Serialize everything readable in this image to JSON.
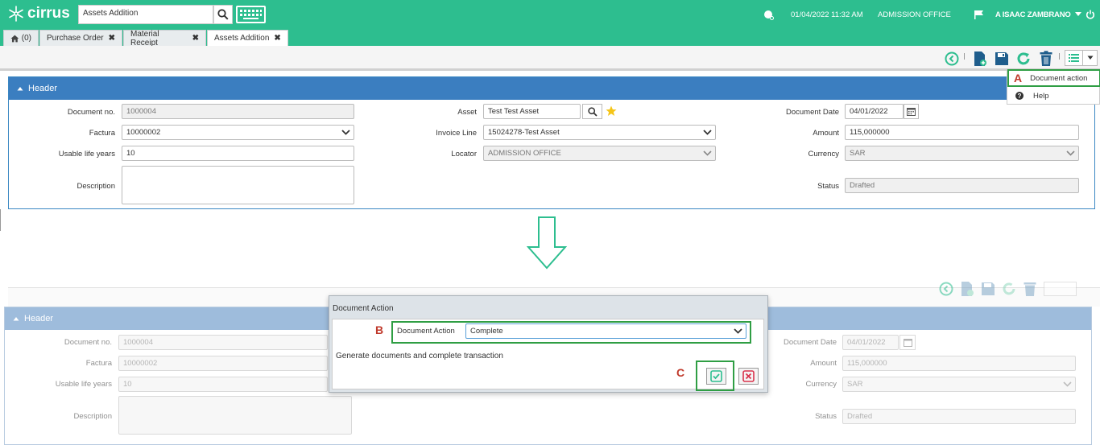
{
  "app": {
    "brand": "cirrus",
    "search_value": "Assets Addition"
  },
  "topbar": {
    "datetime": "01/04/2022 11:32 AM",
    "org": "ADMISSION OFFICE",
    "user": "A ISAAC ZAMBRANO"
  },
  "tabs": [
    {
      "label": "(0)"
    },
    {
      "label": "Purchase Order"
    },
    {
      "label": "Material Receipt"
    },
    {
      "label": "Assets Addition"
    }
  ],
  "header": {
    "title": "Header"
  },
  "form": {
    "document_no": {
      "label": "Document no.",
      "value": "1000004"
    },
    "factura": {
      "label": "Factura",
      "value": "10000002"
    },
    "usable_life": {
      "label": "Usable life years",
      "value": "10"
    },
    "description": {
      "label": "Description",
      "value": ""
    },
    "asset": {
      "label": "Asset",
      "value": "Test Test Asset"
    },
    "invoice_line": {
      "label": "Invoice Line",
      "value": "15024278-Test Asset"
    },
    "locator": {
      "label": "Locator",
      "value": "ADMISSION OFFICE"
    },
    "document_date": {
      "label": "Document Date",
      "value": "04/01/2022"
    },
    "amount": {
      "label": "Amount",
      "value": "115,000000"
    },
    "currency": {
      "label": "Currency",
      "value": "SAR"
    },
    "status": {
      "label": "Status",
      "value": "Drafted"
    }
  },
  "menu": {
    "document_action": "Document action",
    "help": "Help"
  },
  "markers": {
    "a": "A",
    "b": "B",
    "c": "C"
  },
  "dialog": {
    "title": "Document Action",
    "field_label": "Document Action",
    "field_value": "Complete",
    "description": "Generate documents and complete transaction"
  },
  "colors": {
    "topbar": "#2dbe8f",
    "header": "#3b7ec0",
    "highlight": "#2f9e44",
    "marker": "#c0392b"
  }
}
